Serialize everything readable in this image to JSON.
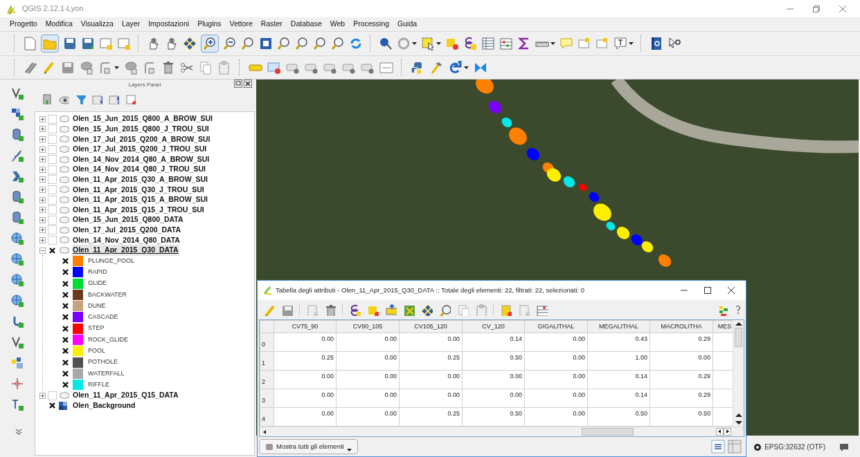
{
  "window": {
    "title": "QGIS 2.12.1-Lyon"
  },
  "menu": [
    "Progetto",
    "Modifica",
    "Visualizza",
    "Layer",
    "Impostazioni",
    "Plugins",
    "Vettore",
    "Raster",
    "Database",
    "Web",
    "Processing",
    "Guida"
  ],
  "layers_panel": {
    "title": "Layers Panel",
    "layers": [
      {
        "name": "Olen_15_Jun_2015_Q800_A_BROW_SUI",
        "kind": "vector",
        "checked": false,
        "expanded": false,
        "selected": false
      },
      {
        "name": "Olen_15_Jun_2015_Q800_J_TROU_SUI",
        "kind": "vector",
        "checked": false,
        "expanded": false,
        "selected": false
      },
      {
        "name": "Olen_17_Jul_2015_Q200_A_BROW_SUI",
        "kind": "vector",
        "checked": false,
        "expanded": false,
        "selected": false
      },
      {
        "name": "Olen_17_Jul_2015_Q200_J_TROU_SUI",
        "kind": "vector",
        "checked": false,
        "expanded": false,
        "selected": false
      },
      {
        "name": "Olen_14_Nov_2014_Q80_A_BROW_SUI",
        "kind": "vector",
        "checked": false,
        "expanded": false,
        "selected": false
      },
      {
        "name": "Olen_14_Nov_2014_Q80_J_TROU_SUI",
        "kind": "vector",
        "checked": false,
        "expanded": false,
        "selected": false
      },
      {
        "name": "Olen_11_Apr_2015_Q30_A_BROW_SUI",
        "kind": "vector",
        "checked": false,
        "expanded": false,
        "selected": false
      },
      {
        "name": "Olen_11_Apr_2015_Q30_J_TROU_SUI",
        "kind": "vector",
        "checked": false,
        "expanded": false,
        "selected": false
      },
      {
        "name": "Olen_11_Apr_2015_Q15_A_BROW_SUI",
        "kind": "vector",
        "checked": false,
        "expanded": false,
        "selected": false
      },
      {
        "name": "Olen_11_Apr_2015_Q15_J_TROU_SUI",
        "kind": "vector",
        "checked": false,
        "expanded": false,
        "selected": false
      },
      {
        "name": "Olen_15_Jun_2015_Q800_DATA",
        "kind": "vector",
        "checked": false,
        "expanded": false,
        "selected": false
      },
      {
        "name": "Olen_17_Jul_2015_Q200_DATA",
        "kind": "vector",
        "checked": false,
        "expanded": false,
        "selected": false
      },
      {
        "name": "Olen_14_Nov_2014_Q80_DATA",
        "kind": "vector",
        "checked": false,
        "expanded": false,
        "selected": false
      },
      {
        "name": "Olen_11_Apr_2015_Q30_DATA",
        "kind": "vector",
        "checked": true,
        "expanded": true,
        "selected": true,
        "children": [
          {
            "name": "PLUNGE_POOL",
            "color": "#ff8000",
            "checked": true
          },
          {
            "name": "RAPID",
            "color": "#0000ff",
            "checked": true
          },
          {
            "name": "GLIDE",
            "color": "#00dd33",
            "checked": true
          },
          {
            "name": "BACKWATER",
            "color": "#6b3a1e",
            "checked": true
          },
          {
            "name": "DUNE",
            "color": "#c8a27a",
            "checked": true
          },
          {
            "name": "CASCADE",
            "color": "#7a00ff",
            "checked": true
          },
          {
            "name": "STEP",
            "color": "#ff0000",
            "checked": true
          },
          {
            "name": "ROCK_GLIDE",
            "color": "#ff00ff",
            "checked": true
          },
          {
            "name": "POOL",
            "color": "#ffee00",
            "checked": true
          },
          {
            "name": "POTHOLE",
            "color": "#505050",
            "checked": true
          },
          {
            "name": "WATERFALL",
            "color": "#a8a8a8",
            "checked": true
          },
          {
            "name": "RIFFLE",
            "color": "#00e8e8",
            "checked": true
          }
        ]
      },
      {
        "name": "Olen_11_Apr_2015_Q15_DATA",
        "kind": "vector",
        "checked": false,
        "expanded": false,
        "selected": false
      },
      {
        "name": "Olen_Background",
        "kind": "raster",
        "checked": true,
        "selected": false
      }
    ]
  },
  "attribute_table": {
    "title": "Tabella degli attributi - Olen_11_Apr_2015_Q30_DATA :: Totale degli elementi: 22, filtrati: 22, selezionati: 0",
    "columns": [
      "CV75_90",
      "CV90_105",
      "CV105_120",
      "CV_120",
      "GIGALITHAL",
      "MEGALITHAL",
      "MACROLITHA",
      "MES"
    ],
    "rows": [
      {
        "index": "0",
        "cells": [
          "0.00",
          "0.00",
          "0.00",
          "0.14",
          "0.00",
          "0.43",
          "0.29"
        ]
      },
      {
        "index": "1",
        "cells": [
          "0.25",
          "0.00",
          "0.25",
          "0.50",
          "0.00",
          "1.00",
          "0.00"
        ]
      },
      {
        "index": "2",
        "cells": [
          "0.00",
          "0.00",
          "0.00",
          "0.00",
          "0.00",
          "0.14",
          "0.29"
        ]
      },
      {
        "index": "3",
        "cells": [
          "0.00",
          "0.00",
          "0.00",
          "0.00",
          "0.00",
          "0.14",
          "0.29"
        ]
      },
      {
        "index": "4",
        "cells": [
          "0.00",
          "0.00",
          "0.25",
          "0.50",
          "0.00",
          "0.50",
          "0.50"
        ]
      }
    ],
    "filter_button": "Mostra tutti gli elementi"
  },
  "status_bar": {
    "crs": "EPSG:32632 (OTF)"
  }
}
